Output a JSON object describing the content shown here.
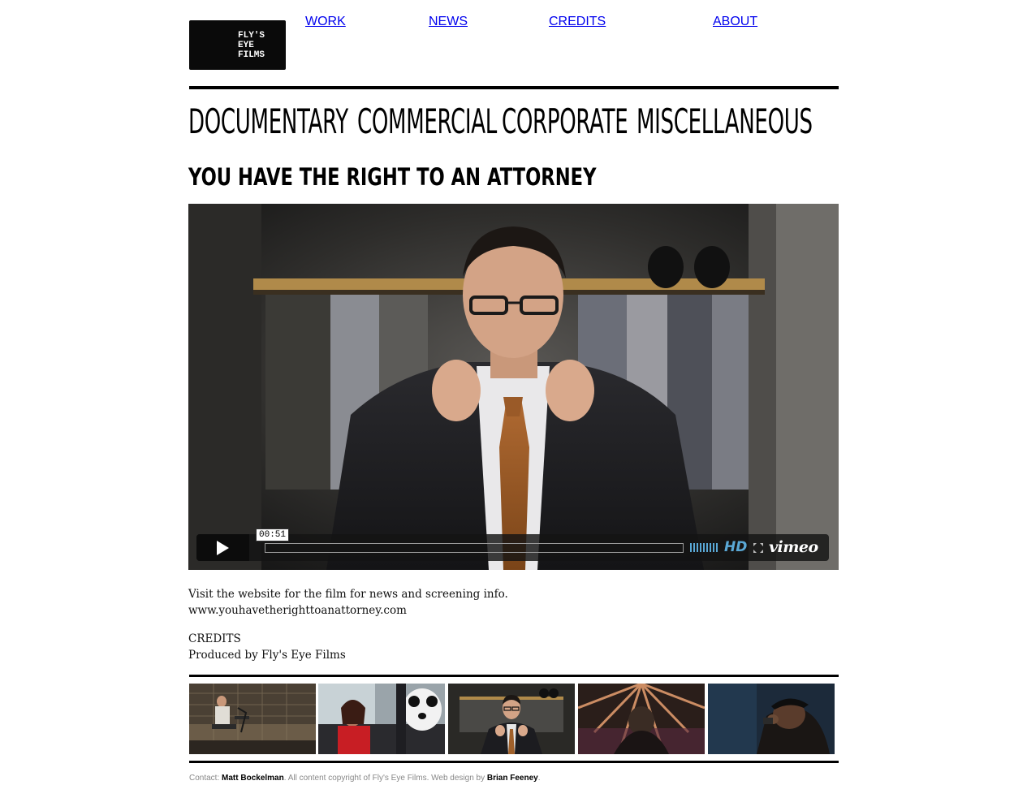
{
  "logo": {
    "text": "FLY'S\nEYE\nFILMS"
  },
  "main_nav": [
    "WORK",
    "NEWS",
    "CREDITS",
    "ABOUT"
  ],
  "sub_nav": [
    "DOCUMENTARY",
    "COMMERCIAL",
    "CORPORATE",
    "MISCELLANEOUS"
  ],
  "page_title": "YOU HAVE THE RIGHT TO AN ATTORNEY",
  "player": {
    "timecode": "00:51",
    "hd_label": "HD",
    "brand": "vimeo",
    "icons": [
      "play-icon",
      "volume-icon",
      "fullscreen-icon"
    ]
  },
  "description": {
    "line1": "Visit the website for the film for news and screening info.",
    "line2": "www.youhavetherighttoanattorney.com"
  },
  "credits": {
    "heading": "CREDITS",
    "line1": "Produced by Fly's Eye Films"
  },
  "thumbnails": [
    "thumbnail-1",
    "thumbnail-2",
    "thumbnail-3",
    "thumbnail-4",
    "thumbnail-5"
  ],
  "footer": {
    "contact_label": "Contact:",
    "contact_name": "Matt Bockelman",
    "copyright": ". All content copyright of Fly's Eye Films. Web design by",
    "designer": "Brian Feeney",
    "end": "."
  },
  "colors": {
    "hd_blue": "#5aa8d6",
    "background": "#ffffff",
    "text": "#000000"
  }
}
